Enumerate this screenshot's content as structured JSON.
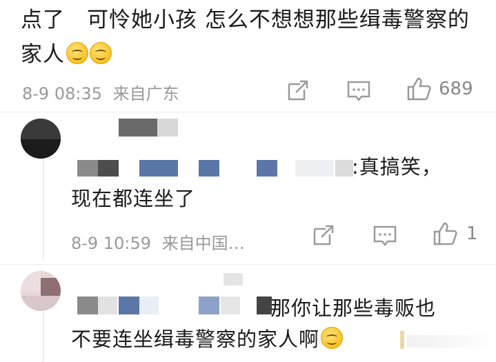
{
  "comment": {
    "text": "点了　可怜她小孩 怎么不想想那些缉毒警察的家人",
    "timestamp": "8-9 08:35",
    "source": "来自广东",
    "like_count": "689"
  },
  "replies": [
    {
      "text_line1": ":真搞笑，",
      "text_line2": "现在都连坐了",
      "timestamp": "8-9 10:59",
      "source": "来自中国…",
      "like_count": "1"
    },
    {
      "text_line1": "那你让那些毒贩也",
      "text_line2": "不要连坐缉毒警察的家人啊"
    }
  ],
  "icons": {
    "share": "share-icon",
    "comment": "comment-icon",
    "like": "thumbs-up-icon",
    "emoji": "smile-emoji-icon"
  },
  "colors": {
    "meta_text": "#999999",
    "redaction_blue": "#5b77a8",
    "redaction_gray": "#555555"
  }
}
